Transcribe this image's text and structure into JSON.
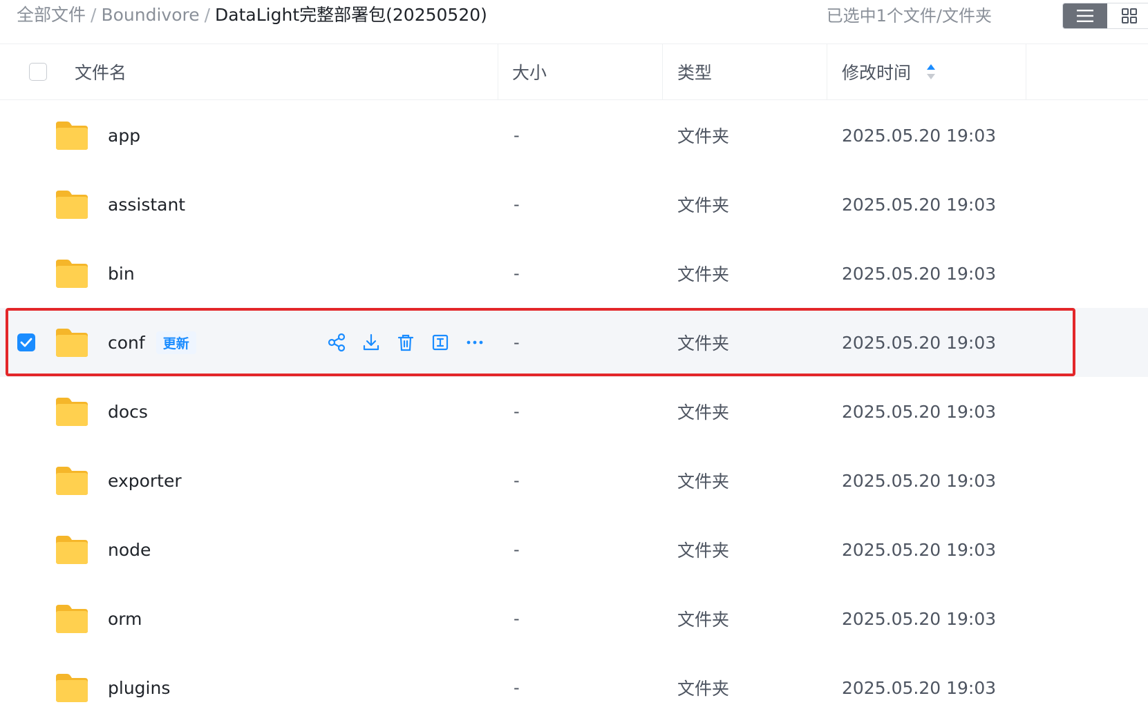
{
  "breadcrumb": {
    "root": "全部文件",
    "separator": "/",
    "parent": "Boundivore",
    "current": "DataLight完整部署包(20250520)"
  },
  "selection_status": "已选中1个文件/文件夹",
  "view_toggle": {
    "active": "list-view-icon",
    "inactive": "grid-view-icon"
  },
  "columns": {
    "name": "文件名",
    "size": "大小",
    "type": "类型",
    "modified": "修改时间"
  },
  "rows": [
    {
      "name": "app",
      "size": "-",
      "type": "文件夹",
      "modified": "2025.05.20 19:03",
      "selected": false
    },
    {
      "name": "assistant",
      "size": "-",
      "type": "文件夹",
      "modified": "2025.05.20 19:03",
      "selected": false
    },
    {
      "name": "bin",
      "size": "-",
      "type": "文件夹",
      "modified": "2025.05.20 19:03",
      "selected": false
    },
    {
      "name": "conf",
      "size": "-",
      "type": "文件夹",
      "modified": "2025.05.20 19:03",
      "selected": true,
      "tag": "更新"
    },
    {
      "name": "docs",
      "size": "-",
      "type": "文件夹",
      "modified": "2025.05.20 19:03",
      "selected": false
    },
    {
      "name": "exporter",
      "size": "-",
      "type": "文件夹",
      "modified": "2025.05.20 19:03",
      "selected": false
    },
    {
      "name": "node",
      "size": "-",
      "type": "文件夹",
      "modified": "2025.05.20 19:03",
      "selected": false
    },
    {
      "name": "orm",
      "size": "-",
      "type": "文件夹",
      "modified": "2025.05.20 19:03",
      "selected": false
    },
    {
      "name": "plugins",
      "size": "-",
      "type": "文件夹",
      "modified": "2025.05.20 19:03",
      "selected": false
    }
  ],
  "row_actions": [
    "share-icon",
    "download-icon",
    "delete-icon",
    "rename-icon",
    "more-icon"
  ],
  "colors": {
    "accent": "#1a8cff",
    "highlight": "#e3272a",
    "folder": "#ffc83d"
  }
}
